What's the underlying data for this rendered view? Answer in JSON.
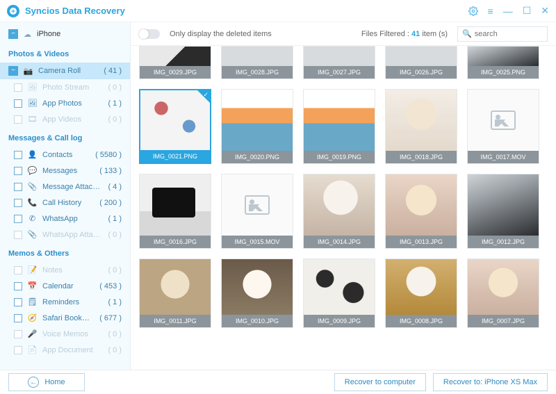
{
  "app_title": "Syncios Data Recovery",
  "device_label": "iPhone",
  "sections": {
    "photos": {
      "header": "Photos & Videos",
      "items": [
        {
          "label": "Camera Roll",
          "count": "( 41 )",
          "icon": "camera",
          "selected": true,
          "collapse": true
        },
        {
          "label": "Photo Stream",
          "count": "( 0 )",
          "icon": "photo",
          "disabled": true
        },
        {
          "label": "App Photos",
          "count": "( 1 )",
          "icon": "appphoto"
        },
        {
          "label": "App Videos",
          "count": "( 0 )",
          "icon": "appvideo",
          "disabled": true
        }
      ]
    },
    "messages": {
      "header": "Messages & Call log",
      "items": [
        {
          "label": "Contacts",
          "count": "( 5580 )",
          "icon": "contacts"
        },
        {
          "label": "Messages",
          "count": "( 133 )",
          "icon": "messages"
        },
        {
          "label": "Message Attach...",
          "count": "( 4 )",
          "icon": "attach"
        },
        {
          "label": "Call History",
          "count": "( 200 )",
          "icon": "call"
        },
        {
          "label": "WhatsApp",
          "count": "( 1 )",
          "icon": "whatsapp"
        },
        {
          "label": "WhatsApp Attach...",
          "count": "( 0 )",
          "icon": "whatsapp-attach",
          "disabled": true
        }
      ]
    },
    "memos": {
      "header": "Memos & Others",
      "items": [
        {
          "label": "Notes",
          "count": "( 0 )",
          "icon": "notes",
          "disabled": true
        },
        {
          "label": "Calendar",
          "count": "( 453 )",
          "icon": "calendar"
        },
        {
          "label": "Reminders",
          "count": "( 1 )",
          "icon": "reminders"
        },
        {
          "label": "Safari Bookmark",
          "count": "( 677 )",
          "icon": "safari"
        },
        {
          "label": "Voice Memos",
          "count": "( 0 )",
          "icon": "voice",
          "disabled": true
        },
        {
          "label": "App Document",
          "count": "( 0 )",
          "icon": "appdoc",
          "disabled": true
        }
      ]
    }
  },
  "toolbar": {
    "toggle_label": "Only display the deleted items",
    "filtered_prefix": "Files Filtered : ",
    "filtered_count": "41",
    "filtered_suffix": " item (s)",
    "search_placeholder": "search"
  },
  "thumbs": {
    "r0": [
      {
        "cap": "IMG_0029.JPG",
        "ph": "ph-bag"
      },
      {
        "cap": "IMG_0028.JPG",
        "ph": "ph-grey"
      },
      {
        "cap": "IMG_0027.JPG",
        "ph": "ph-grey"
      },
      {
        "cap": "IMG_0026.JPG",
        "ph": "ph-grey"
      },
      {
        "cap": "IMG_0025.PNG",
        "ph": "ph-dark"
      }
    ],
    "r1": [
      {
        "cap": "IMG_0021.PNG",
        "ph": "ph-collage",
        "sel": true
      },
      {
        "cap": "IMG_0020.PNG",
        "ph": "ph-memories"
      },
      {
        "cap": "IMG_0019.PNG",
        "ph": "ph-memories"
      },
      {
        "cap": "IMG_0018.JPG",
        "ph": "ph-kitten"
      },
      {
        "cap": "IMG_0017.MOV",
        "placeholder": true
      }
    ],
    "r2": [
      {
        "cap": "IMG_0016.JPG",
        "ph": "ph-phone"
      },
      {
        "cap": "IMG_0015.MOV",
        "placeholder": true
      },
      {
        "cap": "IMG_0014.JPG",
        "ph": "ph-cat4"
      },
      {
        "cap": "IMG_0013.JPG",
        "ph": "ph-cat1"
      },
      {
        "cap": "IMG_0012.JPG",
        "ph": "ph-dark"
      }
    ],
    "r3": [
      {
        "cap": "IMG_0011.JPG",
        "ph": "ph-cat3"
      },
      {
        "cap": "IMG_0010.JPG",
        "ph": "ph-cat2"
      },
      {
        "cap": "IMG_0009.JPG",
        "ph": "ph-cow"
      },
      {
        "cap": "IMG_0008.JPG",
        "ph": "ph-gold"
      },
      {
        "cap": "IMG_0007.JPG",
        "ph": "ph-cat1"
      }
    ]
  },
  "footer": {
    "home": "Home",
    "recover_pc": "Recover to computer",
    "recover_device": "Recover to: iPhone XS Max"
  }
}
